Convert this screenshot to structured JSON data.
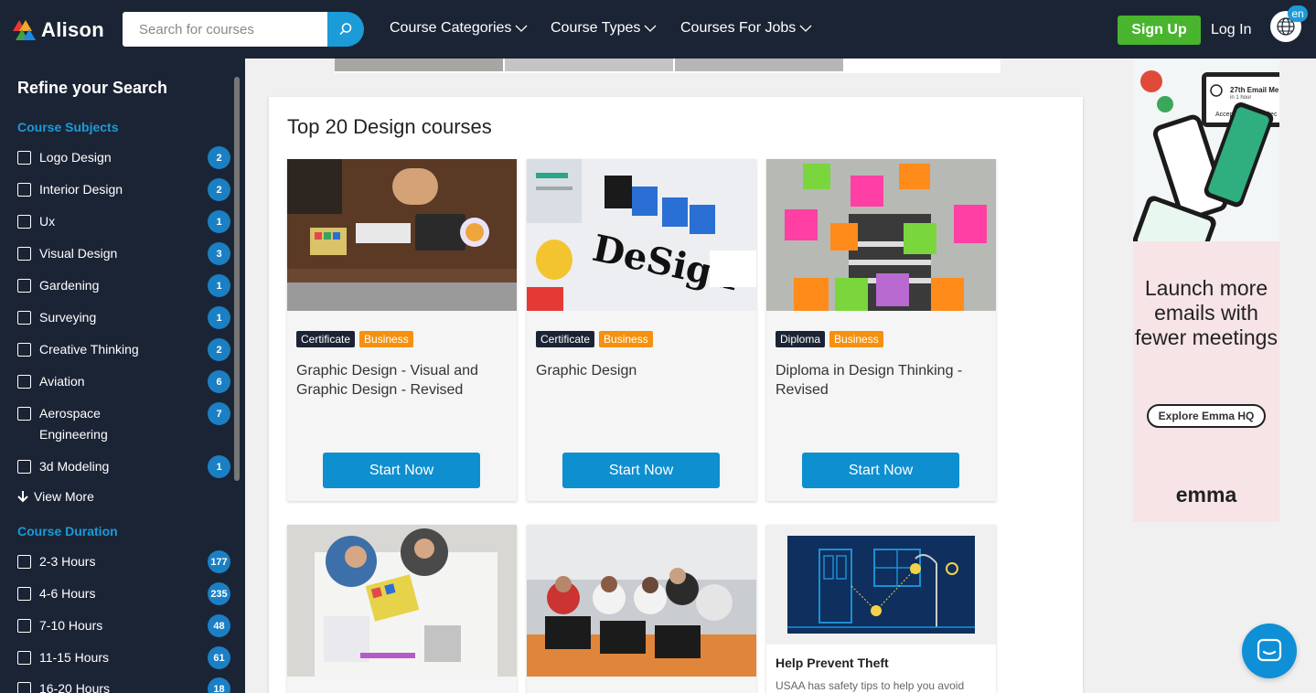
{
  "header": {
    "brand": "Alison",
    "search_placeholder": "Search for courses",
    "nav": [
      "Course Categories",
      "Course Types",
      "Courses For Jobs"
    ],
    "signup": "Sign Up",
    "login": "Log In",
    "language": "en"
  },
  "sidebar": {
    "title": "Refine your Search",
    "subjects_heading": "Course Subjects",
    "subjects": [
      {
        "label": "Logo Design",
        "count": "2"
      },
      {
        "label": "Interior Design",
        "count": "2"
      },
      {
        "label": "Ux",
        "count": "1"
      },
      {
        "label": "Visual Design",
        "count": "3"
      },
      {
        "label": "Gardening",
        "count": "1"
      },
      {
        "label": "Surveying",
        "count": "1"
      },
      {
        "label": "Creative Thinking",
        "count": "2"
      },
      {
        "label": "Aviation",
        "count": "6"
      },
      {
        "label": "Aerospace Engineering",
        "count": "7"
      },
      {
        "label": "3d Modeling",
        "count": "1"
      }
    ],
    "view_more": "View More",
    "duration_heading": "Course Duration",
    "durations": [
      {
        "label": "2-3 Hours",
        "count": "177"
      },
      {
        "label": "4-6 Hours",
        "count": "235"
      },
      {
        "label": "7-10 Hours",
        "count": "48"
      },
      {
        "label": "11-15 Hours",
        "count": "61"
      },
      {
        "label": "16-20 Hours",
        "count": "18"
      }
    ]
  },
  "main": {
    "title": "Top 20 Design courses",
    "cards": [
      {
        "type": "Certificate",
        "category": "Business",
        "title": "Graphic Design - Visual and Graphic Design - Revised",
        "button": "Start Now"
      },
      {
        "type": "Certificate",
        "category": "Business",
        "title": "Graphic Design",
        "button": "Start Now"
      },
      {
        "type": "Diploma",
        "category": "Business",
        "title": "Diploma in Design Thinking - Revised",
        "button": "Start Now"
      }
    ],
    "ad_card": {
      "title": "Help Prevent Theft",
      "text": "USAA has safety tips to help you avoid"
    }
  },
  "right_ad": {
    "headline": "Launch more emails with fewer meetings",
    "cta": "Explore Emma HQ",
    "brand": "emma",
    "phone_text": "27th Email Me",
    "phone_sub": "in 1 hour",
    "phone_accept": "Accept",
    "phone_decline": "Dec"
  },
  "colors": {
    "header_bg": "#1b2435",
    "accent_blue": "#1b9bd8",
    "signup_green": "#49b52e",
    "tag_orange": "#f5910f",
    "button_blue": "#0d8fd0"
  }
}
